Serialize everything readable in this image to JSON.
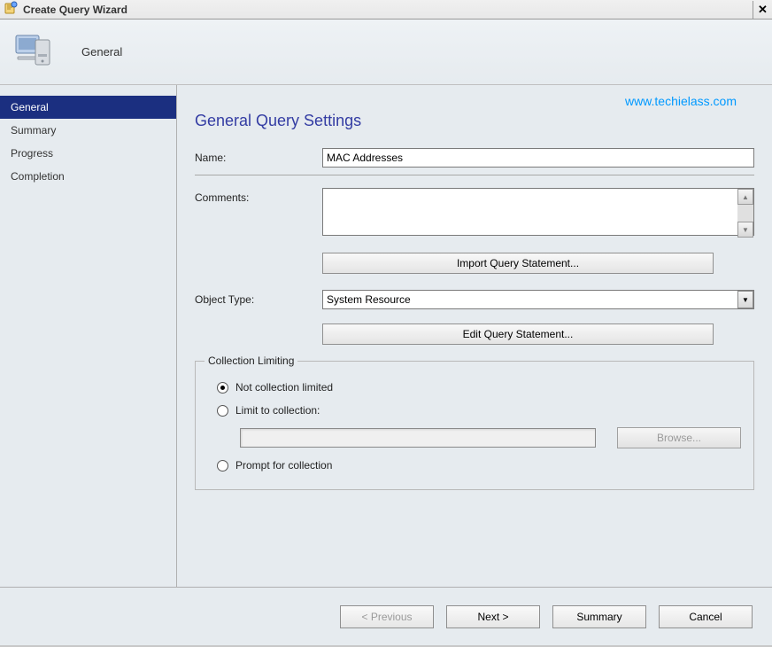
{
  "titlebar": {
    "title": "Create Query Wizard"
  },
  "banner": {
    "title": "General"
  },
  "sidebar": {
    "items": [
      {
        "label": "General",
        "active": true
      },
      {
        "label": "Summary",
        "active": false
      },
      {
        "label": "Progress",
        "active": false
      },
      {
        "label": "Completion",
        "active": false
      }
    ]
  },
  "watermark": "www.techielass.com",
  "page": {
    "title": "General Query Settings",
    "name_label": "Name:",
    "name_value": "MAC Addresses",
    "comments_label": "Comments:",
    "comments_value": "",
    "import_btn": "Import Query Statement...",
    "object_type_label": "Object Type:",
    "object_type_value": "System Resource",
    "edit_btn": "Edit Query Statement..."
  },
  "collection": {
    "legend": "Collection Limiting",
    "opt_not_limited": "Not collection limited",
    "opt_limit_to": "Limit to collection:",
    "browse_btn": "Browse...",
    "opt_prompt": "Prompt for collection"
  },
  "footer": {
    "previous": "< Previous",
    "next": "Next >",
    "summary": "Summary",
    "cancel": "Cancel"
  }
}
